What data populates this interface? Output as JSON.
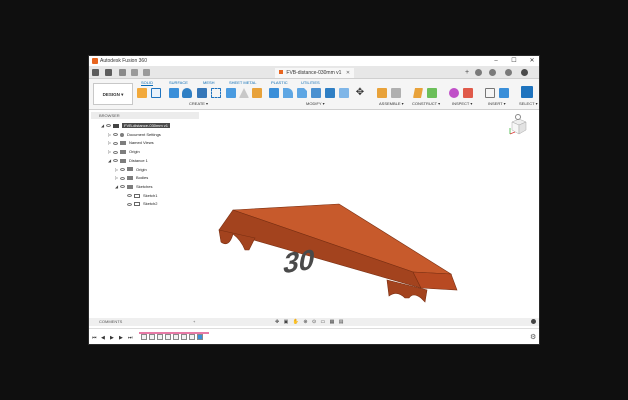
{
  "window": {
    "app_title": "Autodesk Fusion 360",
    "controls": {
      "minimize": "–",
      "maximize": "☐",
      "close": "✕"
    }
  },
  "document": {
    "tab_title": "FVB-distance-030mm v1",
    "tab_close": "✕",
    "new_tab": "+"
  },
  "toolbar": {
    "workspace_label": "DESIGN ▾",
    "tabs": [
      "SOLID",
      "SURFACE",
      "MESH",
      "SHEET METAL",
      "PLASTIC",
      "UTILITIES"
    ],
    "active_tab": "SOLID",
    "groups": [
      "CREATE ▾",
      "MODIFY ▾",
      "ASSEMBLE ▾",
      "CONSTRUCT ▾",
      "INSPECT ▾",
      "INSERT ▾",
      "SELECT ▾"
    ]
  },
  "browser": {
    "title": "BROWSER",
    "items": [
      {
        "label": "FVB-distance-030mm v1",
        "indent": 0,
        "tri": "◢",
        "icon": "document-icon",
        "selected": true
      },
      {
        "label": "Document Settings",
        "indent": 1,
        "tri": "▷",
        "icon": "gear-icon"
      },
      {
        "label": "Named Views",
        "indent": 1,
        "tri": "▷",
        "icon": "folder-icon"
      },
      {
        "label": "Origin",
        "indent": 1,
        "tri": "▷",
        "icon": "folder-icon"
      },
      {
        "label": "Distance 1",
        "indent": 1,
        "tri": "◢",
        "icon": "component-icon"
      },
      {
        "label": "Origin",
        "indent": 2,
        "tri": "▷",
        "icon": "folder-icon"
      },
      {
        "label": "Bodies",
        "indent": 2,
        "tri": "▷",
        "icon": "folder-icon"
      },
      {
        "label": "Sketches",
        "indent": 2,
        "tri": "◢",
        "icon": "folder-icon"
      },
      {
        "label": "Sketch1",
        "indent": 3,
        "tri": "",
        "icon": "sketch-icon"
      },
      {
        "label": "Sketch2",
        "indent": 3,
        "tri": "",
        "icon": "sketch-icon"
      }
    ]
  },
  "model": {
    "engraved_text": "30",
    "body_color": "#c75a2c",
    "body_side_color": "#a3431e",
    "text_color": "#4a4a4a"
  },
  "comments": {
    "label": "COMMENTS"
  },
  "timeline": {
    "controls": [
      "⏮",
      "◀",
      "▶",
      "▶",
      "⏭"
    ]
  },
  "colors": {
    "accent": "#0b6cb5",
    "titlebar_bg": "#ffffff",
    "canvas_bg": "#ffffff"
  }
}
